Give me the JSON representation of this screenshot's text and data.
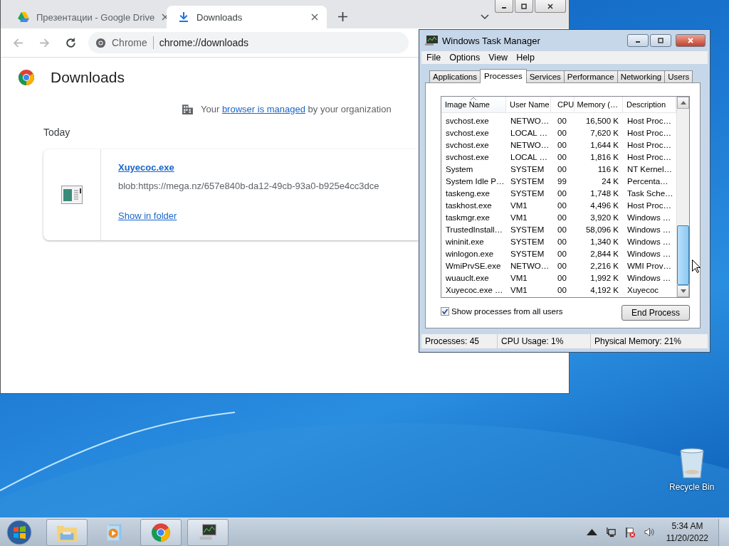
{
  "browser": {
    "tabs": [
      {
        "kind": "drive",
        "title": "Презентации - Google Drive",
        "selected": false
      },
      {
        "kind": "download",
        "title": "Downloads",
        "selected": true
      }
    ],
    "address": {
      "site": "Chrome",
      "url": "chrome://downloads"
    },
    "page": {
      "title": "Downloads",
      "managed": {
        "before": "Your",
        "link": "browser is managed",
        "after": "by your organization"
      },
      "section": "Today",
      "item": {
        "file_name": "Xuyecoc.exe",
        "url": "blob:https://mega.nz/657e840b-da12-49cb-93a0-b925e4cc3dce",
        "action": "Show in folder"
      }
    }
  },
  "task_manager": {
    "title": "Windows Task Manager",
    "menu": [
      "File",
      "Options",
      "View",
      "Help"
    ],
    "tabs": [
      {
        "label": "Applications",
        "selected": false
      },
      {
        "label": "Processes",
        "selected": true
      },
      {
        "label": "Services",
        "selected": false
      },
      {
        "label": "Performance",
        "selected": false
      },
      {
        "label": "Networking",
        "selected": false
      },
      {
        "label": "Users",
        "selected": false
      }
    ],
    "columns": [
      {
        "label": "Image Name",
        "sorted": true
      },
      {
        "label": "User Name",
        "sorted": false
      },
      {
        "label": "CPU",
        "sorted": false
      },
      {
        "label": "Memory (…",
        "sorted": false
      },
      {
        "label": "Description",
        "sorted": false
      }
    ],
    "rows": [
      [
        "svchost.exe",
        "NETWO…",
        "00",
        "16,500 K",
        "Host Proc…"
      ],
      [
        "svchost.exe",
        "LOCAL …",
        "00",
        "7,620 K",
        "Host Proc…"
      ],
      [
        "svchost.exe",
        "NETWO…",
        "00",
        "1,644 K",
        "Host Proc…"
      ],
      [
        "svchost.exe",
        "LOCAL …",
        "00",
        "1,816 K",
        "Host Proc…"
      ],
      [
        "System",
        "SYSTEM",
        "00",
        "116 K",
        "NT Kernel…"
      ],
      [
        "System Idle P…",
        "SYSTEM",
        "99",
        "24 K",
        "Percenta…"
      ],
      [
        "taskeng.exe",
        "SYSTEM",
        "00",
        "1,748 K",
        "Task Sche…"
      ],
      [
        "taskhost.exe",
        "VM1",
        "00",
        "4,496 K",
        "Host Proc…"
      ],
      [
        "taskmgr.exe",
        "VM1",
        "00",
        "3,920 K",
        "Windows …"
      ],
      [
        "TrustedInstall…",
        "SYSTEM",
        "00",
        "58,096 K",
        "Windows …"
      ],
      [
        "wininit.exe",
        "SYSTEM",
        "00",
        "1,340 K",
        "Windows …"
      ],
      [
        "winlogon.exe",
        "SYSTEM",
        "00",
        "2,844 K",
        "Windows …"
      ],
      [
        "WmiPrvSE.exe",
        "NETWO…",
        "00",
        "2,216 K",
        "WMI Prov…"
      ],
      [
        "wuauclt.exe",
        "VM1",
        "00",
        "1,992 K",
        "Windows …"
      ],
      [
        "Xuyecoc.exe …",
        "VM1",
        "00",
        "4,192 K",
        "Xuyecoc"
      ]
    ],
    "show_all": {
      "label": "Show processes from all users",
      "checked": true
    },
    "button": "End Process",
    "status": [
      "Processes: 45",
      "CPU Usage: 1%",
      "Physical Memory: 21%"
    ]
  },
  "desktop": {
    "icons": [
      {
        "label": "Recycle Bin"
      }
    ]
  },
  "taskbar": {
    "apps": [
      {
        "kind": "explorer",
        "open": true
      },
      {
        "kind": "media",
        "open": false
      },
      {
        "kind": "chrome",
        "open": true
      },
      {
        "kind": "taskmgr",
        "open": true
      }
    ],
    "time": "5:34 AM",
    "date": "11/20/2022"
  }
}
